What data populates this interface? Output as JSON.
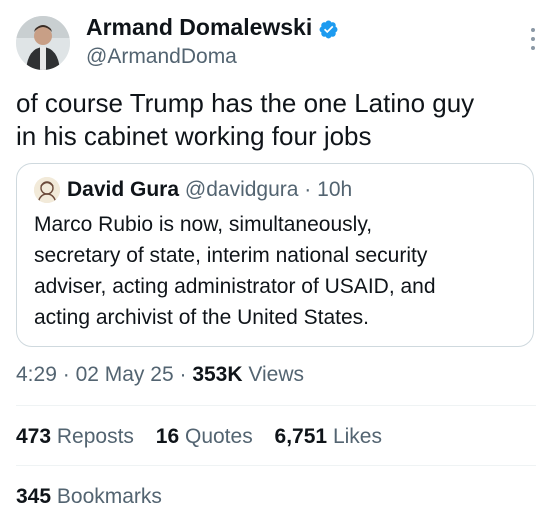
{
  "author": {
    "name": "Armand Domalewski",
    "handle": "@ArmandDoma",
    "verified": true,
    "avatar_icon": "user-avatar",
    "verified_icon": "verified-badge-icon",
    "more_icon": "more-options-icon"
  },
  "tweet": {
    "text": "of course Trump has the one Latino guy\nin his cabinet working four jobs"
  },
  "quote": {
    "author_name": "David Gura",
    "author_handle": "@davidgura",
    "separator": "·",
    "time": "10h",
    "text": "Marco Rubio is now, simultaneously,\nsecretary of state, interim national security\nadviser, acting administrator of USAID, and\nacting archivist of the United States."
  },
  "meta": {
    "time": "4:29",
    "date": "02 May 25",
    "separator": "·",
    "views_count": "353K",
    "views_label": "Views"
  },
  "stats": {
    "reposts_count": "473",
    "reposts_label": "Reposts",
    "quotes_count": "16",
    "quotes_label": "Quotes",
    "likes_count": "6,751",
    "likes_label": "Likes",
    "bookmarks_count": "345",
    "bookmarks_label": "Bookmarks"
  },
  "colors": {
    "text": "#0f1419",
    "secondary": "#536471",
    "verified": "#1d9bf0",
    "border": "#cfd9de"
  }
}
